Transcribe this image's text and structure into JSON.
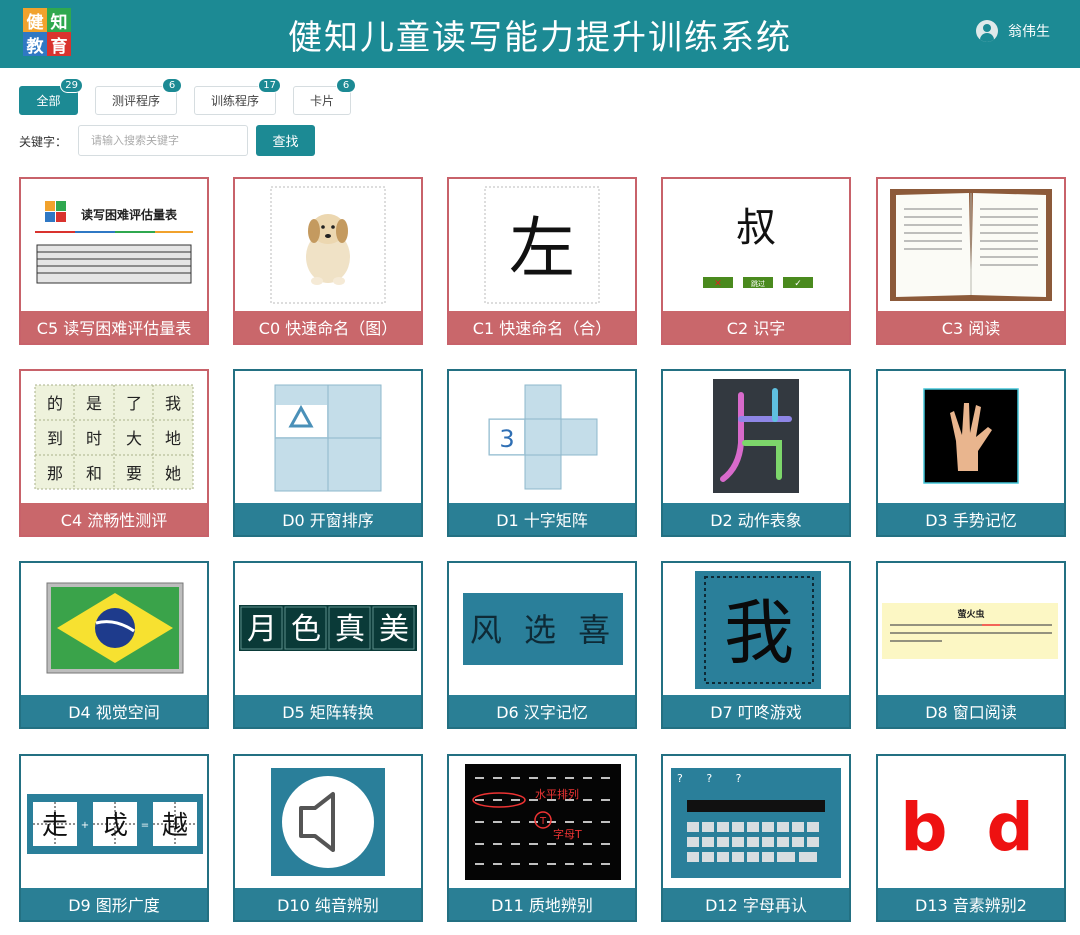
{
  "header": {
    "logo_chars": [
      "健",
      "知",
      "教",
      "育"
    ],
    "logo_colors": [
      "#f1a22c",
      "#2fa84f",
      "#2f78c4",
      "#d9332e"
    ],
    "title": "健知儿童读写能力提升训练系统",
    "user_name": "翁伟生"
  },
  "tabs": [
    {
      "label": "全部",
      "count": "29"
    },
    {
      "label": "测评程序",
      "count": "6"
    },
    {
      "label": "训练程序",
      "count": "17"
    },
    {
      "label": "卡片",
      "count": "6"
    }
  ],
  "search": {
    "label": "关键字：",
    "placeholder": "请输入搜索关键字",
    "button": "查找"
  },
  "cards": [
    {
      "label": "C5 读写困难评估量表",
      "thumb_text": "读写困难评估量表"
    },
    {
      "label": "C0 快速命名（图）"
    },
    {
      "label": "C1 快速命名（合）",
      "thumb_text": "左"
    },
    {
      "label": "C2 识字",
      "thumb_text": "叔",
      "buttons": [
        "✕",
        "跳过",
        "✓"
      ]
    },
    {
      "label": "C3 阅读"
    },
    {
      "label": "C4 流畅性测评",
      "grid": [
        "的",
        "是",
        "了",
        "我",
        "到",
        "时",
        "大",
        "地",
        "那",
        "和",
        "要",
        "她"
      ]
    },
    {
      "label": "D0 开窗排序"
    },
    {
      "label": "D1 十字矩阵",
      "thumb_text": "3"
    },
    {
      "label": "D2 动作表象"
    },
    {
      "label": "D3 手势记忆"
    },
    {
      "label": "D4 视觉空间"
    },
    {
      "label": "D5 矩阵转换",
      "chars": [
        "月",
        "色",
        "真",
        "美"
      ]
    },
    {
      "label": "D6 汉字记忆",
      "thumb_text": "风 选 喜"
    },
    {
      "label": "D7 叮咚游戏",
      "thumb_text": "我"
    },
    {
      "label": "D8 窗口阅读",
      "thumb_text": "萤火虫"
    },
    {
      "label": "D9 图形广度",
      "chars": [
        "走",
        "戉",
        "越"
      ]
    },
    {
      "label": "D10 纯音辨别"
    },
    {
      "label": "D11 质地辨别",
      "annotations": [
        "水平排列",
        "字母T",
        "T"
      ]
    },
    {
      "label": "D12 字母再认",
      "thumb_text": "? ? ?"
    },
    {
      "label": "D13 音素辨别2",
      "thumb_text": "b d"
    }
  ]
}
